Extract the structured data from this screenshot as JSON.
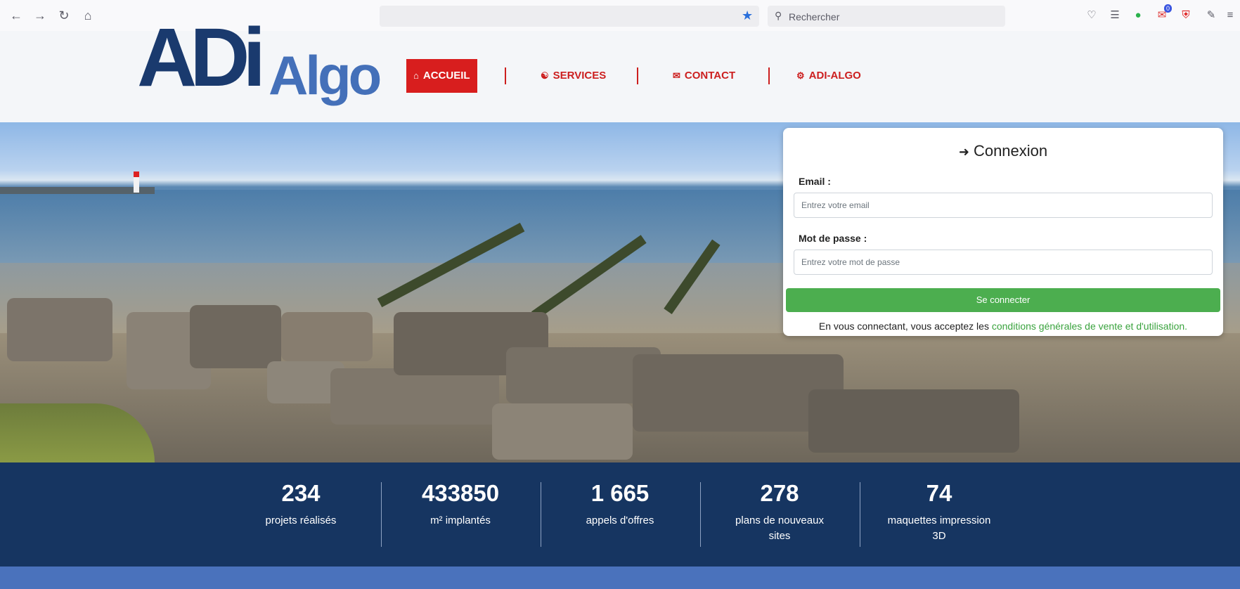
{
  "browser": {
    "search_placeholder": "Rechercher",
    "icons": [
      "back-icon",
      "forward-icon",
      "reload-icon",
      "home-icon",
      "bookmark-star-icon",
      "search-icon",
      "pocket-icon",
      "library-icon",
      "check-extension-icon",
      "mail-extension-icon",
      "shield-extension-icon",
      "extensions-icon",
      "menu-icon"
    ],
    "mail_badge": "0"
  },
  "header": {
    "logo_main": "ADi",
    "logo_sub": "Algo",
    "menu": [
      {
        "label": "ACCUEIL",
        "icon": "home-icon",
        "active": true
      },
      {
        "label": "SERVICES",
        "icon": "handshake-icon",
        "active": false
      },
      {
        "label": "CONTACT",
        "icon": "envelope-icon",
        "active": false
      },
      {
        "label": "ADI-ALGO",
        "icon": "gears-icon",
        "active": false
      }
    ],
    "colors": {
      "logo_dark": "#1a3a6e",
      "logo_light": "#4470b9",
      "menu_red": "#d81e1e"
    }
  },
  "login": {
    "title": "Connexion",
    "email_label": "Email :",
    "email_placeholder": "Entrez votre email",
    "password_label": "Mot de passe :",
    "password_placeholder": "Entrez votre mot de passe",
    "submit_label": "Se connecter",
    "terms_text": "En vous connectant, vous acceptez les ",
    "terms_link": "conditions générales de vente et d'utilisation."
  },
  "stats": [
    {
      "value": "234",
      "label": "projets réalisés"
    },
    {
      "value": "433850",
      "label": "m² implantés"
    },
    {
      "value": "1 665",
      "label": "appels d'offres"
    },
    {
      "value": "278",
      "label": "plans de nouveaux sites"
    },
    {
      "value": "74",
      "label": "maquettes impression 3D"
    }
  ],
  "colors": {
    "stats_bg": "#163561",
    "bottom_band": "#4a72bc",
    "submit_green": "#4cae4f"
  }
}
